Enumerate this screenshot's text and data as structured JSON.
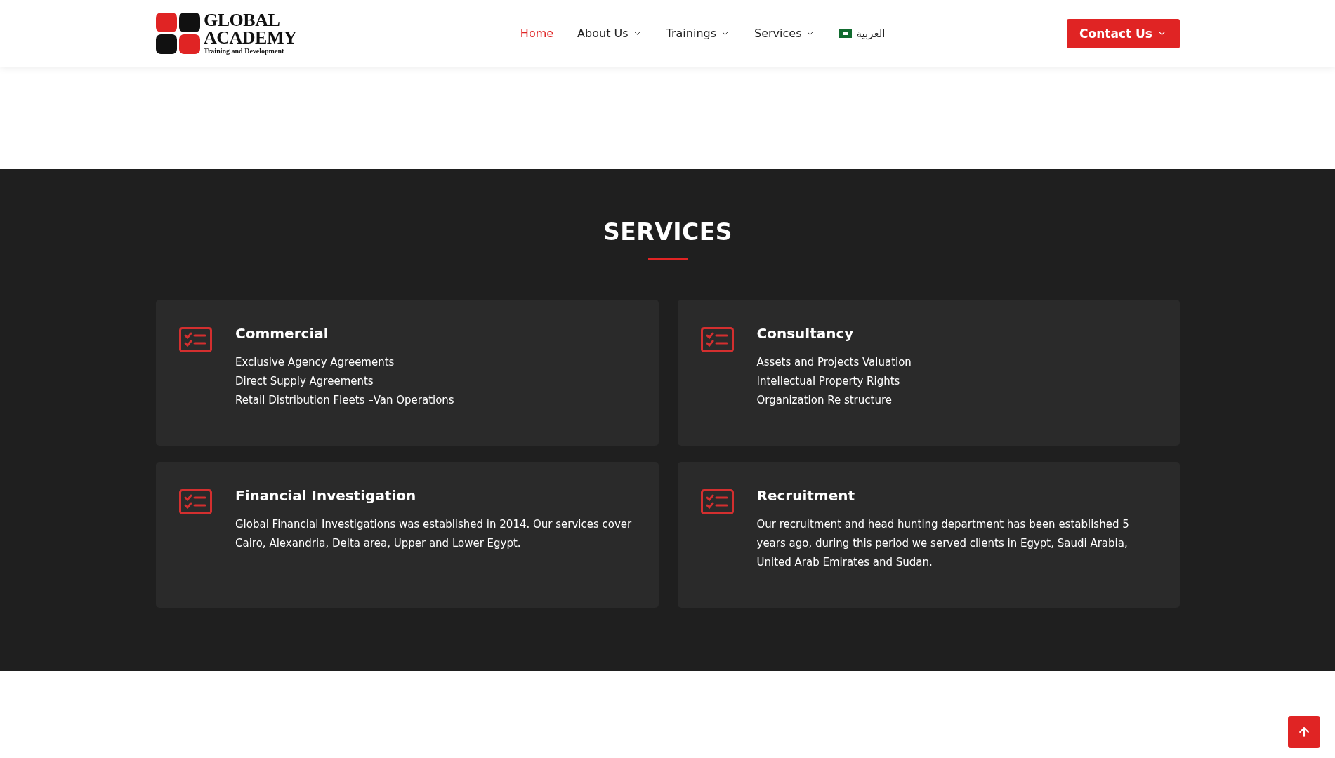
{
  "logo": {
    "line_1": "GLOBAL",
    "line_2": "ACADEMY",
    "tagline": "Training and Development"
  },
  "nav": [
    {
      "label": "Home",
      "selected": true,
      "dropdown": false
    },
    {
      "label": "About Us",
      "selected": false,
      "dropdown": true
    },
    {
      "label": "Trainings",
      "selected": false,
      "dropdown": true
    },
    {
      "label": "Services",
      "selected": false,
      "dropdown": true
    }
  ],
  "language": {
    "label": "العربية"
  },
  "contact_button": {
    "label": "Contact Us"
  },
  "section": {
    "title": "SERVICES"
  },
  "cards": [
    {
      "title": "Commercial",
      "kind": "list",
      "items": [
        "Exclusive Agency Agreements",
        "Direct Supply Agreements",
        "Retail Distribution Fleets –Van Operations"
      ]
    },
    {
      "title": "Consultancy",
      "kind": "list",
      "items": [
        "Assets and Projects Valuation",
        "Intellectual Property Rights",
        "Organization Re structure"
      ]
    },
    {
      "title": "Financial Investigation",
      "kind": "paragraph",
      "text": "Global Financial Investigations was established in 2014. Our services cover Cairo, Alexandria, Delta area, Upper and Lower Egypt."
    },
    {
      "title": "Recruitment",
      "kind": "paragraph",
      "text": "Our recruitment and head hunting department has been established 5 years ago, during this period we served clients in Egypt, Saudi Arabia, United Arab Emirates and Sudan."
    }
  ]
}
